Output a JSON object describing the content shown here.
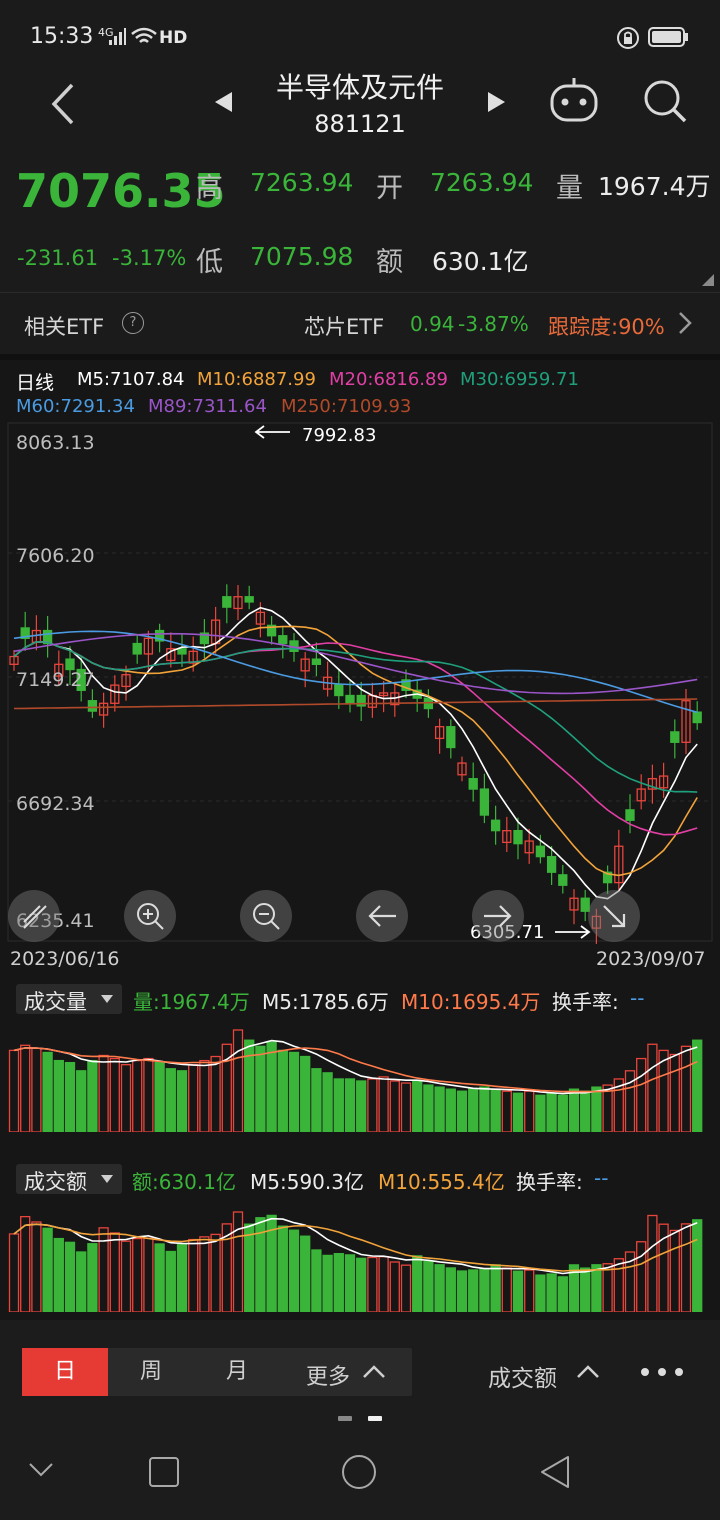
{
  "status": {
    "time": "15:33",
    "signal": "4G",
    "hd": "HD"
  },
  "header": {
    "title": "半导体及元件",
    "code": "881121"
  },
  "quote": {
    "price": "7076.35",
    "change": "-231.61",
    "change_pct": "-3.17%",
    "high_label": "高",
    "high": "7263.94",
    "open_label": "开",
    "open": "7263.94",
    "volume_label": "量",
    "volume": "1967.4万",
    "low_label": "低",
    "low": "7075.98",
    "amount_label": "额",
    "amount": "630.1亿"
  },
  "etf": {
    "label": "相关ETF",
    "info_icon": "?",
    "name": "芯片ETF",
    "price": "0.94",
    "change_pct": "-3.87%",
    "tracking": "跟踪度:90%"
  },
  "kline": {
    "period": "日线",
    "ma": [
      {
        "text": "M5:7107.84",
        "color": "#ffffff"
      },
      {
        "text": "M10:6887.99",
        "color": "#f2a33a"
      },
      {
        "text": "M20:6816.89",
        "color": "#e23fa5"
      },
      {
        "text": "M30:6959.71",
        "color": "#1fa07c"
      },
      {
        "text": "M60:7291.34",
        "color": "#4b9be2"
      },
      {
        "text": "M89:7311.64",
        "color": "#9a55c8"
      },
      {
        "text": "M250:7109.93",
        "color": "#b04a2a"
      }
    ],
    "y_labels": [
      "8063.13",
      "7606.20",
      "7149.27",
      "6692.34",
      "6235.41"
    ],
    "max_label": "7992.83",
    "min_label": "6305.71",
    "start_date": "2023/06/16",
    "end_date": "2023/09/07"
  },
  "volume_panel": {
    "selector": "成交量",
    "value": "量:1967.4万",
    "m5": "M5:1785.6万",
    "m10": "M10:1695.4万",
    "turnover_label": "换手率:",
    "turnover": "--"
  },
  "amount_panel": {
    "selector": "成交额",
    "value": "额:630.1亿",
    "m5": "M5:590.3亿",
    "m10": "M10:555.4亿",
    "turnover_label": "换手率:",
    "turnover": "--"
  },
  "tabs": {
    "day": "日",
    "week": "周",
    "month": "月",
    "more": "更多",
    "indicator": "成交额"
  },
  "colors": {
    "up": "#e8453c",
    "down": "#3ab53a",
    "active_tab": "#e63a35"
  }
}
